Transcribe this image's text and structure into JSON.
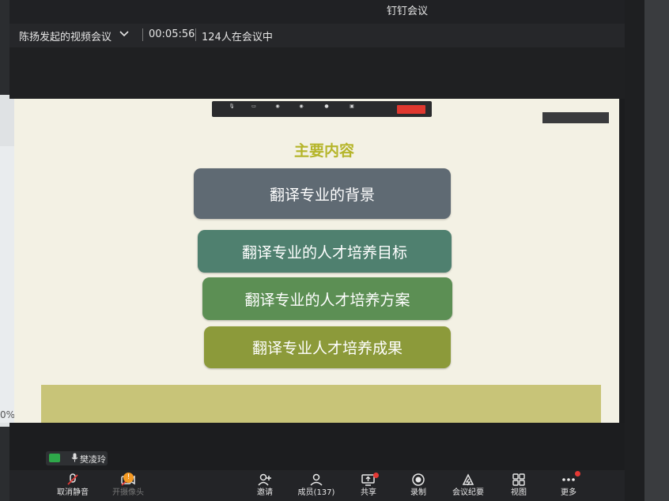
{
  "window": {
    "title": "钉钉会议"
  },
  "info_bar": {
    "meeting_name": "陈扬发起的视频会议",
    "elapsed": "00:05:56",
    "participants_text": "124人在会议中"
  },
  "side_window": {
    "zoom_text": "0%"
  },
  "slide": {
    "heading": "主要内容",
    "items": [
      "翻译专业的背景",
      "翻译专业的人才培养目标",
      "翻译专业的人才培养方案",
      "翻译专业人才培养成果"
    ]
  },
  "speaker": {
    "name": "樊凌玲"
  },
  "toolbar": {
    "unmute": "取消静音",
    "camera": "开摄像头",
    "camera_badge": "!",
    "invite": "邀请",
    "members": "成员(137)",
    "share": "共享",
    "record": "录制",
    "minutes": "会议纪要",
    "view": "视图",
    "more": "更多"
  },
  "colors": {
    "slide_bg": "#f3f1e4",
    "heading": "#b5b52a",
    "box1": "#5f6a73",
    "box2": "#4f806f",
    "box3": "#5c8f54",
    "box4": "#8c9a3a",
    "stop_share": "#e0382f"
  }
}
